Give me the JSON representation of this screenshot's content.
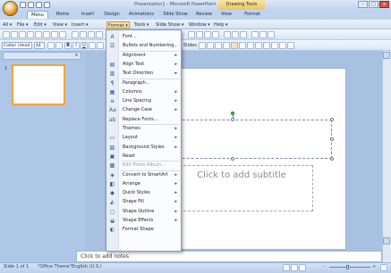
{
  "app": {
    "title": "Presentation1 - Microsoft PowerPoint",
    "context_tab": "Drawing Tools"
  },
  "window_buttons": {
    "minimize": "–",
    "maximize": "□",
    "close": "x"
  },
  "tabs": [
    "Menu",
    "Home",
    "Insert",
    "Design",
    "Animations",
    "Slide Show",
    "Review",
    "View",
    "Format"
  ],
  "menubar": [
    "All ▾",
    "File ▾",
    "Edit ▾",
    "View ▾",
    "Insert ▾",
    "Format ▾",
    "Tools ▾",
    "Slide Show ▾",
    "Window ▾",
    "Help ▾"
  ],
  "toolbar": {
    "font_name": "Calibri (Head",
    "font_size": "44",
    "bold": "B",
    "italic": "I",
    "underline": "U",
    "slides_label": "Slides"
  },
  "format_menu": {
    "items": [
      {
        "label": "Font...",
        "icon": "A",
        "submenu": false,
        "disabled": false
      },
      {
        "label": "Bullets and Numbering...",
        "icon": "☰",
        "submenu": false,
        "disabled": false
      },
      {
        "label": "Alignment",
        "icon": "",
        "submenu": true,
        "disabled": false
      },
      {
        "label": "Align Text",
        "icon": "▤",
        "submenu": true,
        "disabled": false
      },
      {
        "label": "Text Direction",
        "icon": "▥",
        "submenu": true,
        "disabled": false
      },
      {
        "label": "Paragraph...",
        "icon": "¶",
        "submenu": false,
        "disabled": false
      },
      {
        "label": "Columns",
        "icon": "▦",
        "submenu": true,
        "disabled": false
      },
      {
        "label": "Line Spacing",
        "icon": "≡",
        "submenu": true,
        "disabled": false
      },
      {
        "label": "Change Case",
        "icon": "Aa",
        "submenu": true,
        "disabled": false
      },
      {
        "label": "Replace Fonts...",
        "icon": "ab",
        "submenu": false,
        "disabled": false
      },
      {
        "label": "Themes",
        "icon": "",
        "submenu": true,
        "disabled": false
      },
      {
        "label": "Layout",
        "icon": "▭",
        "submenu": true,
        "disabled": false
      },
      {
        "label": "Background Styles",
        "icon": "▧",
        "submenu": true,
        "disabled": false
      },
      {
        "label": "Reset",
        "icon": "▣",
        "submenu": false,
        "disabled": false
      },
      {
        "label": "Edit Photo Album...",
        "icon": "▩",
        "submenu": false,
        "disabled": true
      },
      {
        "label": "Convert to SmartArt",
        "icon": "◈",
        "submenu": true,
        "disabled": false
      },
      {
        "label": "Arrange",
        "icon": "◧",
        "submenu": true,
        "disabled": false
      },
      {
        "label": "Quick Styles",
        "icon": "◆",
        "submenu": true,
        "disabled": false
      },
      {
        "label": "Shape Fill",
        "icon": "◭",
        "submenu": true,
        "disabled": false
      },
      {
        "label": "Shape Outline",
        "icon": "▢",
        "submenu": true,
        "disabled": false
      },
      {
        "label": "Shape Effects",
        "icon": "◒",
        "submenu": true,
        "disabled": false
      },
      {
        "label": "Format Shape",
        "icon": "◐",
        "submenu": false,
        "disabled": false
      }
    ]
  },
  "left_pane": {
    "thumb_number": "1",
    "close": "x"
  },
  "slide": {
    "subtitle_placeholder": "Click to add subtitle"
  },
  "notes": {
    "placeholder": "Click to add notes"
  },
  "status": {
    "slide": "Slide 1 of 1",
    "theme": "\"Office Theme\"",
    "language": "English (U.S.)",
    "zoom_minus": "–",
    "zoom_plus": "+"
  }
}
